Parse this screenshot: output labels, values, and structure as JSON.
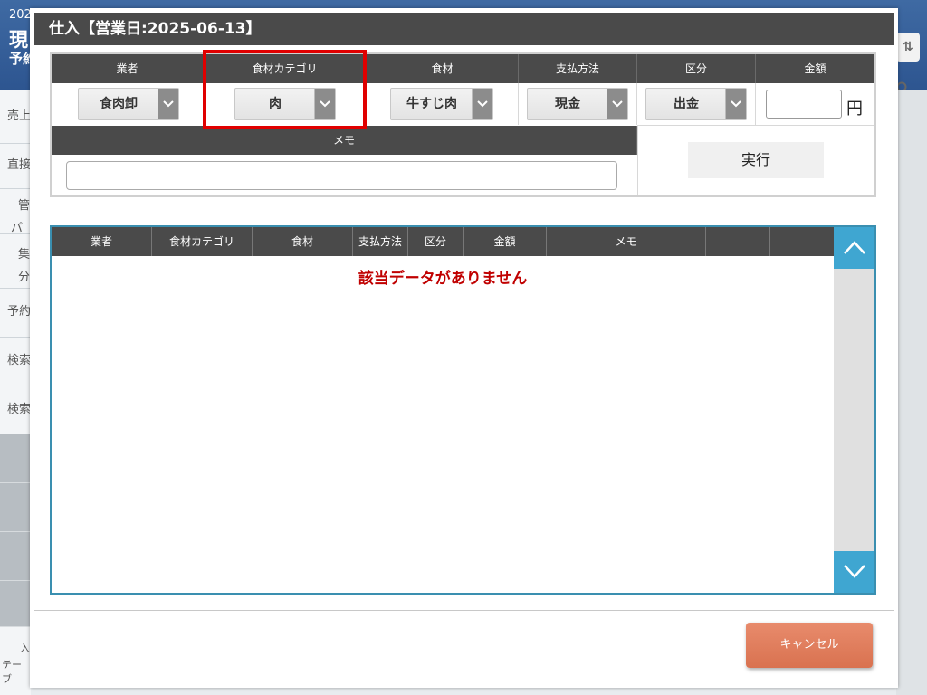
{
  "background": {
    "header_year": "202",
    "header_title": "現",
    "header_sub": "予約",
    "sidebar_items": [
      "売上",
      "直接",
      "管",
      "パ",
      "集",
      "分",
      "予約",
      "検索",
      "検索"
    ],
    "bottom_left_1": "入",
    "bottom_left_2": "テーブ"
  },
  "modal": {
    "title": "仕入【営業日:2025-06-13】",
    "form": {
      "headers": {
        "vendor": "業者",
        "category": "食材カテゴリ",
        "ingredient": "食材",
        "payment": "支払方法",
        "type": "区分",
        "amount": "金額",
        "memo": "メモ"
      },
      "vendor_value": "食肉卸",
      "category_value": "肉",
      "ingredient_value": "牛すじ肉",
      "payment_value": "現金",
      "type_value": "出金",
      "amount_value": "",
      "yen_unit": "円",
      "memo_value": "",
      "execute_label": "実行"
    },
    "table": {
      "columns": [
        "業者",
        "食材カテゴリ",
        "食材",
        "支払方法",
        "区分",
        "金額",
        "メモ",
        "",
        ""
      ],
      "empty_message": "該当データがありません"
    },
    "cancel_label": "キャンセル"
  },
  "colors": {
    "highlight": "#e00000",
    "scroll_accent": "#3fa6d1",
    "cancel": "#d97250",
    "empty_text": "#c00000"
  }
}
